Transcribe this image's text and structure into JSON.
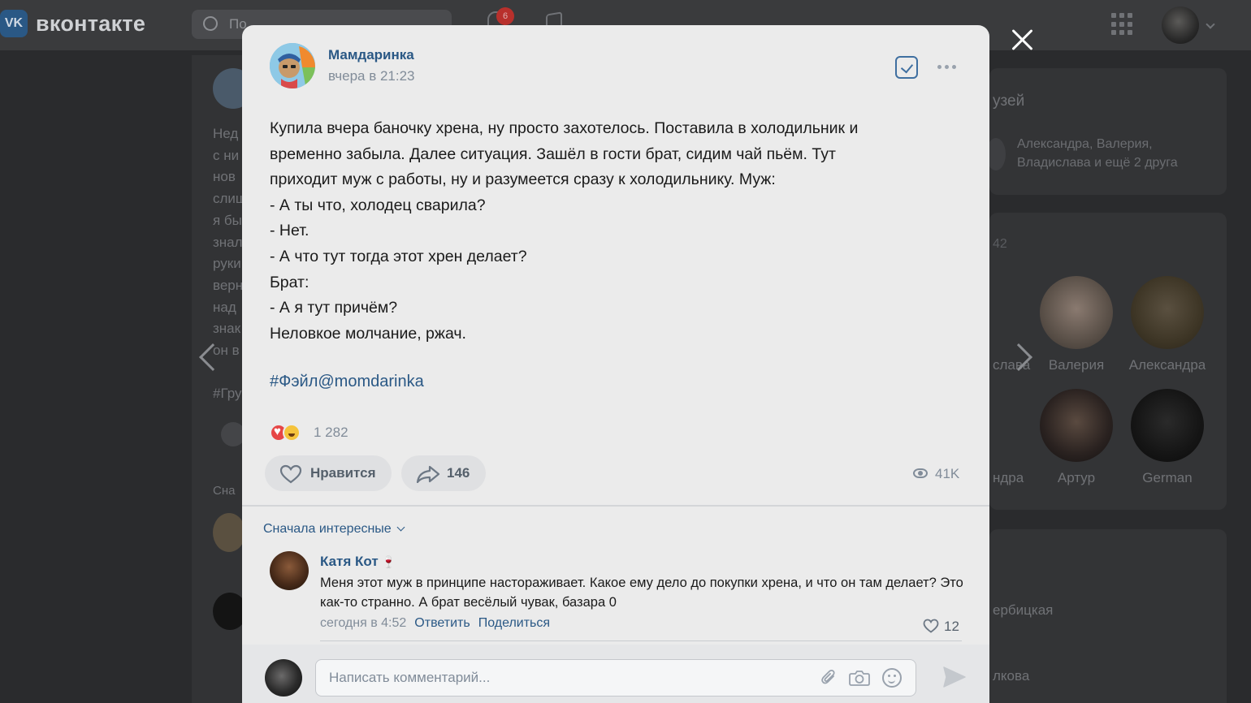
{
  "app": {
    "brand": "вконтакте",
    "logo_text": "VK",
    "notifications_count": "6",
    "search_placeholder": "По"
  },
  "background": {
    "feed_text_lines": [
      "Нед",
      "с ни",
      "нов",
      "слиш",
      "я бы",
      "знал",
      "руки",
      "верн",
      "над",
      "знак",
      "он в"
    ],
    "feed_hashtag": "#Гру",
    "feed_sort": "Сна",
    "right_title": "узей",
    "right_sub": "Александра, Валерия, Владислава и ещё 2 друга",
    "right_count": "42",
    "friends": [
      {
        "name": "Валерия"
      },
      {
        "name": "Александра"
      },
      {
        "name": "Артур"
      },
      {
        "name": "German"
      }
    ],
    "partial_names": [
      "слава",
      "ндра",
      "ербицкая",
      "лкова"
    ]
  },
  "post": {
    "author": "Мамдаринка",
    "time": "вчера в 21:23",
    "lines": [
      "Купила вчера баночку хрена, ну просто захотелось. Поставила в холодильник и",
      "временно забыла. Далее ситуация. Зашёл в гости брат, сидим чай пьём. Тут",
      "приходит муж с работы, ну и разумеется сразу к холодильнику. Муж:",
      "- А ты что, холодец сварила?",
      "- Нет.",
      "- А что тут тогда этот хрен делает?",
      "Брат:",
      "- А я тут причём?",
      "Неловкое молчание, ржач."
    ],
    "hashtag": "#Фэйл@momdarinka",
    "reactions_count": "1 282",
    "like_label": "Нравится",
    "share_count": "146",
    "views": "41K"
  },
  "comments": {
    "sort_label": "Сначала интересные",
    "items": [
      {
        "author": "Катя Кот",
        "author_emoji": "🍷",
        "text": "Меня этот муж в принципе настораживает. Какое ему дело до покупки хрена, и что он там делает? Это как-то странно. А брат весёлый чувак, базара 0",
        "time": "сегодня в 4:52",
        "reply_label": "Ответить",
        "share_label": "Поделиться",
        "likes": "12"
      }
    ],
    "input_placeholder": "Написать комментарий..."
  },
  "colors": {
    "accent": "#2a5885",
    "muted": "#818c99",
    "modal_bg": "#ebebeb",
    "overlay_bg": "#2a2b2d"
  }
}
